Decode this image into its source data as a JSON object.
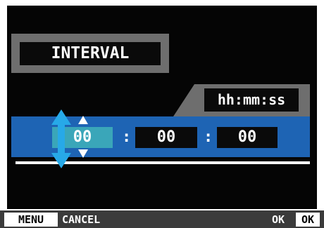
{
  "title": "INTERVAL",
  "format_label": "hh:mm:ss",
  "time": {
    "hours": "00",
    "minutes": "00",
    "seconds": "00",
    "separator": ":"
  },
  "softkeys": {
    "menu_key": "MENU",
    "menu_action": "CANCEL",
    "ok_action": "OK",
    "ok_key": "OK"
  },
  "colors": {
    "background": "#050505",
    "panel": "#6e6e6e",
    "band": "#1e64b4",
    "selected_field": "#3aa6b9",
    "updown_arrow": "#27a9e8"
  },
  "icons": {
    "selector_arrow": "up-down-arrow-icon",
    "increment": "triangle-up-icon",
    "decrement": "triangle-down-icon"
  }
}
